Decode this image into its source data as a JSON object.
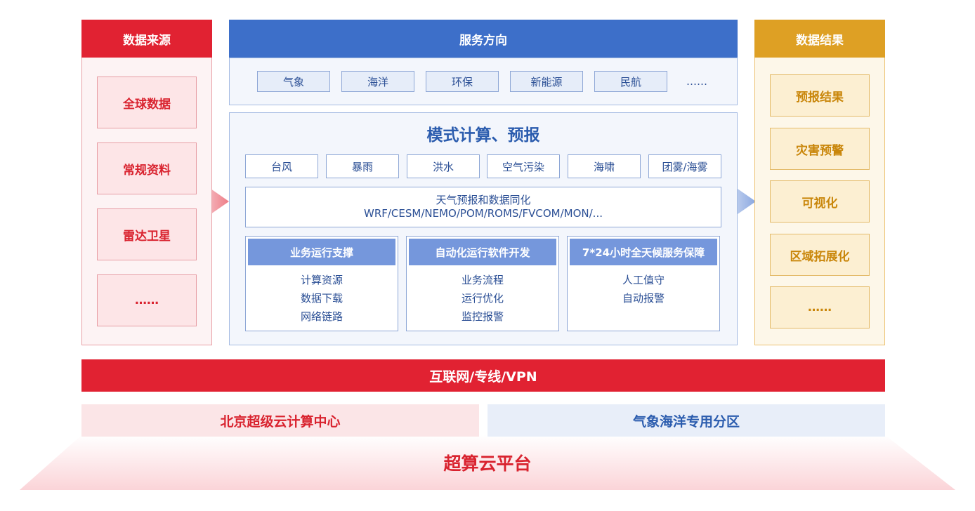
{
  "data_sources": {
    "title": "数据来源",
    "items": [
      "全球数据",
      "常规资料",
      "雷达卫星",
      "……"
    ]
  },
  "service_direction": {
    "title": "服务方向",
    "tags": [
      "气象",
      "海洋",
      "环保",
      "新能源",
      "民航"
    ],
    "more": "……"
  },
  "model": {
    "title": "模式计算、预报",
    "hazards": [
      "台风",
      "暴雨",
      "洪水",
      "空气污染",
      "海啸",
      "团雾/海雾"
    ],
    "wrf_line1": "天气预报和数据同化",
    "wrf_line2": "WRF/CESM/NEMO/POM/ROMS/FVCOM/MON/...",
    "panels": [
      {
        "title": "业务运行支撑",
        "items": [
          "计算资源",
          "数据下载",
          "网络链路"
        ]
      },
      {
        "title": "自动化运行软件开发",
        "items": [
          "业务流程",
          "运行优化",
          "监控报警"
        ]
      },
      {
        "title": "7*24小时全天候服务保障",
        "items": [
          "人工值守",
          "自动报警"
        ]
      }
    ]
  },
  "data_results": {
    "title": "数据结果",
    "items": [
      "预报结果",
      "灾害预警",
      "可视化",
      "区域拓展化",
      "……"
    ]
  },
  "network": "互联网/专线/VPN",
  "beijing_center": "北京超级云计算中心",
  "meteo_partition": "气象海洋专用分区",
  "platform": "超算云平台",
  "colors": {
    "red": "#e12232",
    "blue": "#3d6fc9",
    "gold": "#dea024",
    "panel_blue": "#7597dc"
  }
}
